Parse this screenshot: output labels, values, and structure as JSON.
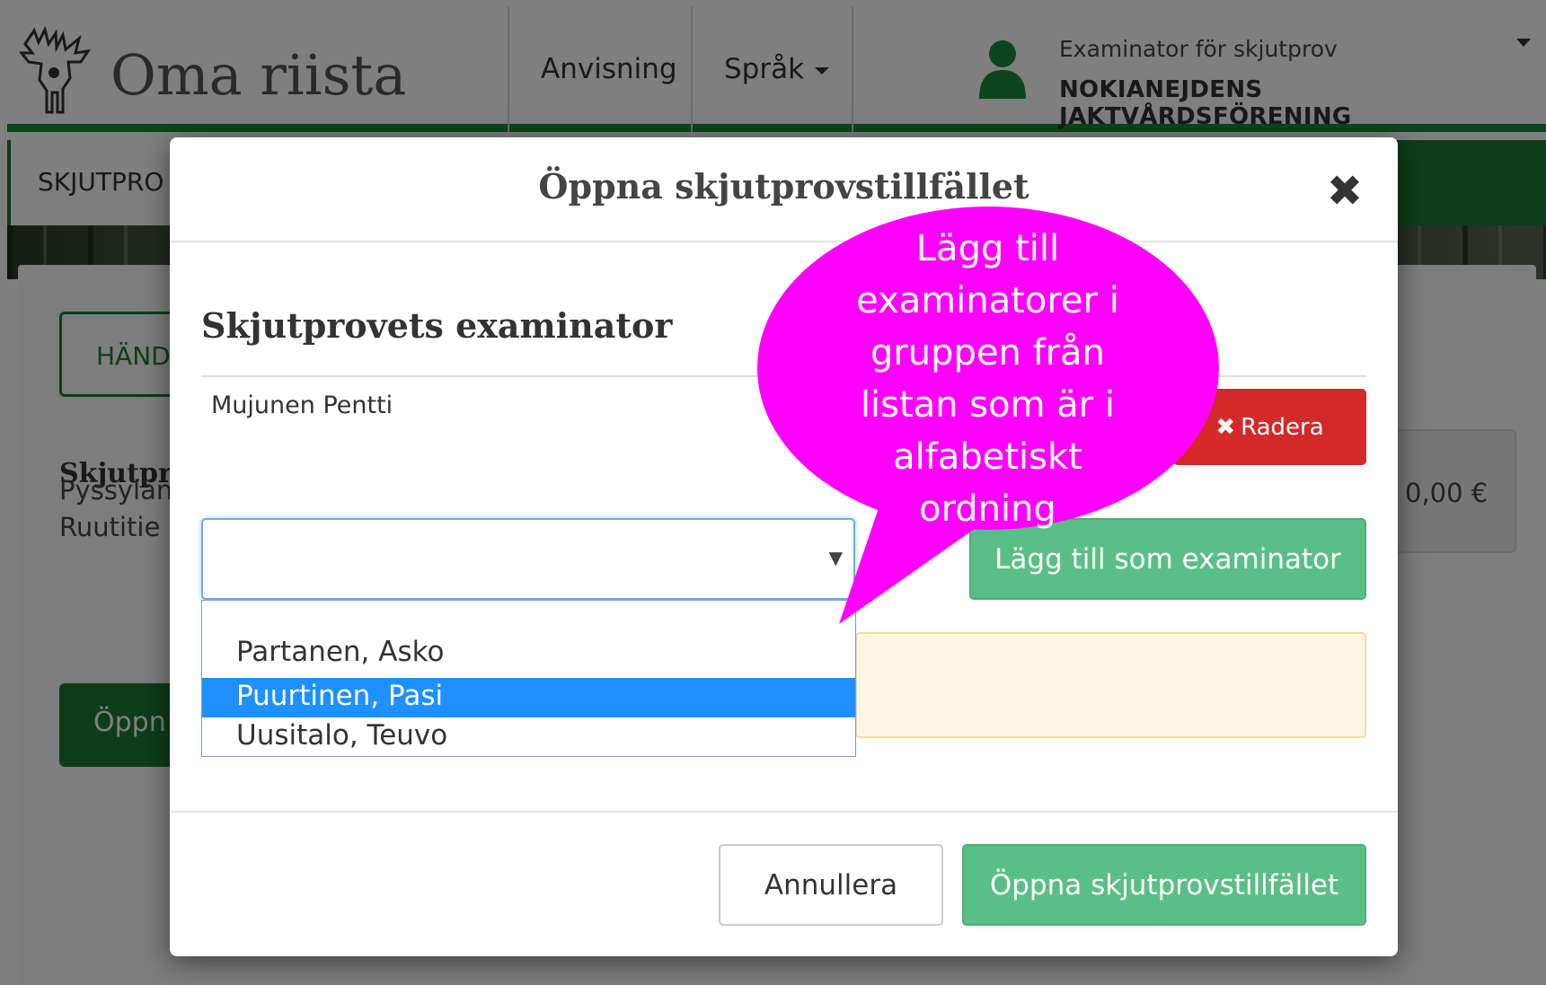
{
  "header": {
    "app_name": "Oma riista",
    "nav": [
      {
        "label": "Anvisning"
      },
      {
        "label": "Språk"
      }
    ],
    "user": {
      "role": "Examinator för skjutprov",
      "organization": "NOKIANEJDENS JAKTVÅRDSFÖRENING"
    }
  },
  "subnav": {
    "active_tab": "SKJUTPRO"
  },
  "background": {
    "outline_button": "HÄND",
    "heading": "Skjutpro",
    "lines": [
      "Pyssylän",
      "Ruutitie"
    ],
    "green_button": "Öppn",
    "price": "0,00 €"
  },
  "modal": {
    "title": "Öppna skjutprovstillfället",
    "close_icon": "close-icon",
    "section_title": "Skjutprovets examinator",
    "examiners": [
      {
        "name": "Mujunen Pentti",
        "delete_label": "Radera"
      }
    ],
    "select": {
      "value": "",
      "options": [
        {
          "label": ""
        },
        {
          "label": "Partanen, Asko"
        },
        {
          "label": "Puurtinen, Pasi",
          "highlighted": true
        },
        {
          "label": "Uusitalo, Teuvo"
        }
      ]
    },
    "add_button": "Lägg till som examinator",
    "cancel_button": "Annullera",
    "submit_button": "Öppna skjutprovstillfället"
  },
  "callout": {
    "text_lines": [
      "Lägg till",
      "examinatorer i",
      "gruppen från",
      "listan som är i",
      "alfabetiskt",
      "ordning"
    ],
    "color": "#ff00ff"
  },
  "colors": {
    "brand_green": "#1b7a33",
    "button_green": "#5abf86",
    "danger_red": "#d42a2a",
    "highlight_blue": "#1e90ff"
  }
}
